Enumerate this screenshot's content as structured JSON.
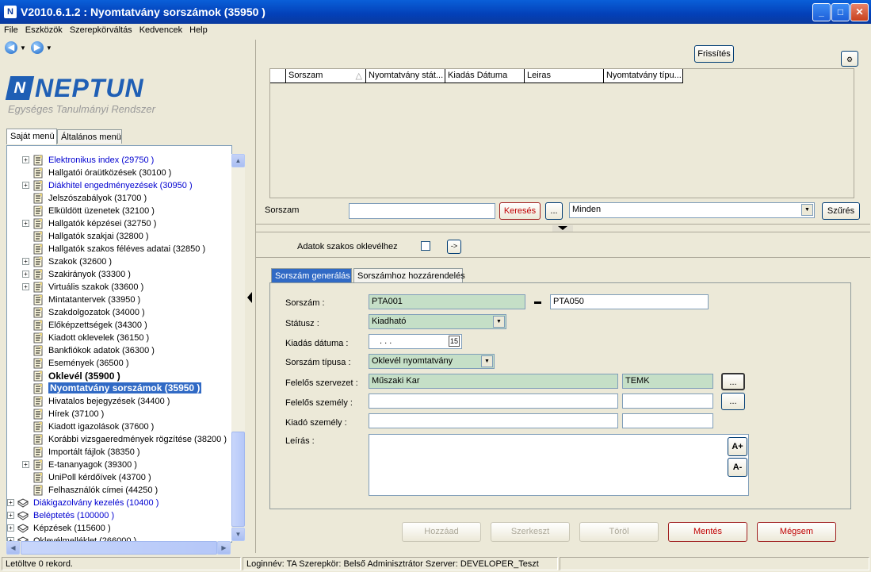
{
  "window": {
    "title": "V2010.6.1.2 : Nyomtatvány sorszámok (35950  )",
    "app_icon": "N"
  },
  "menu": [
    "File",
    "Eszközök",
    "Szerepkörváltás",
    "Kedvencek",
    "Help"
  ],
  "nav": {
    "back_icon": "back-arrow-icon",
    "forward_icon": "forward-arrow-icon"
  },
  "logo": {
    "mark": "N",
    "name": "NEPTUN",
    "subtitle": "Egységes Tanulmányi Rendszer"
  },
  "left_tabs": [
    "Saját menü",
    "Általános menü"
  ],
  "tree": [
    {
      "label": "Elektronikus index (29750  )",
      "level": 2,
      "expand": true,
      "style": "blue"
    },
    {
      "label": "Hallgatói óraütközések (30100  )",
      "level": 2,
      "expand": false,
      "style": "normal"
    },
    {
      "label": "Diákhitel engedményezések (30950  )",
      "level": 2,
      "expand": true,
      "style": "blue"
    },
    {
      "label": "Jelszószabályok (31700  )",
      "level": 2,
      "expand": false,
      "style": "normal"
    },
    {
      "label": "Elküldött üzenetek (32100  )",
      "level": 2,
      "expand": false,
      "style": "normal"
    },
    {
      "label": "Hallgatók képzései (32750  )",
      "level": 2,
      "expand": true,
      "style": "normal"
    },
    {
      "label": "Hallgatók szakjai (32800  )",
      "level": 2,
      "expand": false,
      "style": "normal"
    },
    {
      "label": "Hallgatók szakos féléves adatai (32850  )",
      "level": 2,
      "expand": false,
      "style": "normal"
    },
    {
      "label": "Szakok (32600  )",
      "level": 2,
      "expand": true,
      "style": "normal"
    },
    {
      "label": "Szakirányok (33300  )",
      "level": 2,
      "expand": true,
      "style": "normal"
    },
    {
      "label": "Virtuális szakok (33600  )",
      "level": 2,
      "expand": true,
      "style": "normal"
    },
    {
      "label": "Mintatantervek (33950  )",
      "level": 2,
      "expand": false,
      "style": "normal"
    },
    {
      "label": "Szakdolgozatok (34000  )",
      "level": 2,
      "expand": false,
      "style": "normal"
    },
    {
      "label": "Előképzettségek (34300  )",
      "level": 2,
      "expand": false,
      "style": "normal"
    },
    {
      "label": "Kiadott oklevelek (36150  )",
      "level": 2,
      "expand": false,
      "style": "normal"
    },
    {
      "label": "Bankfiókok adatok (36300  )",
      "level": 2,
      "expand": false,
      "style": "normal"
    },
    {
      "label": "Események (36500  )",
      "level": 2,
      "expand": false,
      "style": "normal"
    },
    {
      "label": "Oklevél (35900  )",
      "level": 2,
      "expand": false,
      "style": "bold"
    },
    {
      "label": "Nyomtatvány sorszámok (35950  )",
      "level": 2,
      "expand": false,
      "style": "selected"
    },
    {
      "label": "Hivatalos bejegyzések (34400  )",
      "level": 2,
      "expand": false,
      "style": "normal"
    },
    {
      "label": "Hírek (37100  )",
      "level": 2,
      "expand": false,
      "style": "normal"
    },
    {
      "label": "Kiadott igazolások (37600  )",
      "level": 2,
      "expand": false,
      "style": "normal"
    },
    {
      "label": "Korábbi vizsgaeredmények rögzítése (38200  )",
      "level": 2,
      "expand": false,
      "style": "normal"
    },
    {
      "label": "Importált fájlok (38350  )",
      "level": 2,
      "expand": false,
      "style": "normal"
    },
    {
      "label": "E-tananyagok (39300  )",
      "level": 2,
      "expand": true,
      "style": "normal"
    },
    {
      "label": "UniPoll kérdőívek (43700  )",
      "level": 2,
      "expand": false,
      "style": "normal"
    },
    {
      "label": "Felhasználók címei (44250  )",
      "level": 2,
      "expand": false,
      "style": "normal"
    },
    {
      "label": "Diákigazolvány kezelés (10400  )",
      "level": 1,
      "expand": true,
      "style": "blue"
    },
    {
      "label": "Beléptetés (100000  )",
      "level": 1,
      "expand": true,
      "style": "blue"
    },
    {
      "label": "Képzések (115600  )",
      "level": 1,
      "expand": true,
      "style": "normal"
    },
    {
      "label": "Oklevélmelléklet (266000  )",
      "level": 1,
      "expand": true,
      "style": "normal"
    }
  ],
  "grid": {
    "refresh_label": "Frissítés",
    "columns": [
      "Sorszam",
      "Nyomtatvány stát...",
      "Kiadás Dátuma",
      "Leiras",
      "Nyomtatvány típu..."
    ]
  },
  "search": {
    "label": "Sorszam",
    "value": "",
    "search_button": "Keresés",
    "more_button": "...",
    "filter_value": "Minden",
    "filter_button": "Szűrés"
  },
  "diploma": {
    "label": "Adatok szakos oklevélhez",
    "go_button": "->"
  },
  "form_tabs": [
    "Sorszám generálás",
    "Sorszámhoz hozzárendelés"
  ],
  "form": {
    "sorszam_label": "Sorszám :",
    "sorszam_from": "PTA001",
    "sorszam_to": "PTA050",
    "statusz_label": "Státusz :",
    "statusz_value": "Kiadható",
    "kiadas_label": "Kiadás dátuma :",
    "kiadas_value": ". . .",
    "kiadas_calendar": "15",
    "tipus_label": "Sorszám típusa :",
    "tipus_value": "Oklevél nyomtatvány",
    "szervezet_label": "Felelős szervezet :",
    "szervezet_name": "Műszaki Kar",
    "szervezet_code": "TEMK",
    "szemely_label": "Felelős személy :",
    "kiado_label": "Kiadó személy :",
    "leiras_label": "Leírás :",
    "font_plus": "A+",
    "font_minus": "A-",
    "lookup_button": "..."
  },
  "actions": {
    "add": "Hozzáad",
    "edit": "Szerkeszt",
    "delete": "Töröl",
    "save": "Mentés",
    "cancel": "Mégsem"
  },
  "status": {
    "records": "Letöltve 0 rekord.",
    "login": "Loginnév: TA   Szerepkör: Belső Adminisztrátor   Szerver: DEVELOPER_Teszt"
  },
  "colors": {
    "accent": "#316ac5",
    "required_field": "#c5dfc7",
    "danger": "#c00000"
  }
}
